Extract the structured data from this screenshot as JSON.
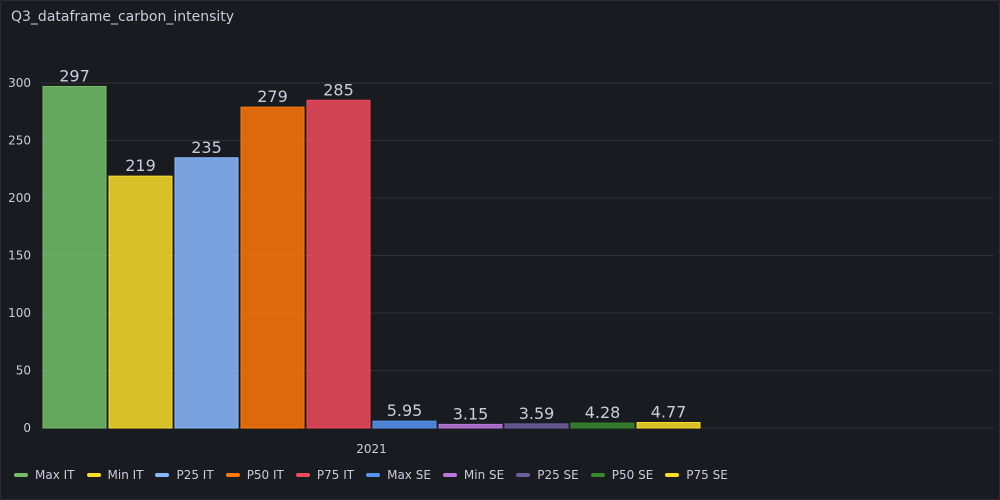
{
  "panel": {
    "title": "Q3_dataframe_carbon_intensity"
  },
  "chart_data": {
    "type": "bar",
    "title": "Q3_dataframe_carbon_intensity",
    "categories": [
      "2021"
    ],
    "ylim": [
      0,
      300
    ],
    "yticks": [
      0,
      50,
      100,
      150,
      200,
      250,
      300
    ],
    "grid": true,
    "legend_position": "bottom",
    "series": [
      {
        "name": "Max IT",
        "values": [
          297
        ],
        "label": "297",
        "color": "#73bf69"
      },
      {
        "name": "Min IT",
        "values": [
          219
        ],
        "label": "219",
        "color": "#fade2a"
      },
      {
        "name": "P25 IT",
        "values": [
          235
        ],
        "label": "235",
        "color": "#8ab8ff"
      },
      {
        "name": "P50 IT",
        "values": [
          279
        ],
        "label": "279",
        "color": "#ff780a"
      },
      {
        "name": "P75 IT",
        "values": [
          285
        ],
        "label": "285",
        "color": "#f2495c"
      },
      {
        "name": "Max SE",
        "values": [
          5.95
        ],
        "label": "5.95",
        "color": "#5794f2"
      },
      {
        "name": "Min SE",
        "values": [
          3.15
        ],
        "label": "3.15",
        "color": "#b877d9"
      },
      {
        "name": "P25 SE",
        "values": [
          3.59
        ],
        "label": "3.59",
        "color": "#705da0"
      },
      {
        "name": "P50 SE",
        "values": [
          4.28
        ],
        "label": "4.28",
        "color": "#37872d"
      },
      {
        "name": "P75 SE",
        "values": [
          4.77
        ],
        "label": "4.77",
        "color": "#fade2a"
      }
    ]
  }
}
